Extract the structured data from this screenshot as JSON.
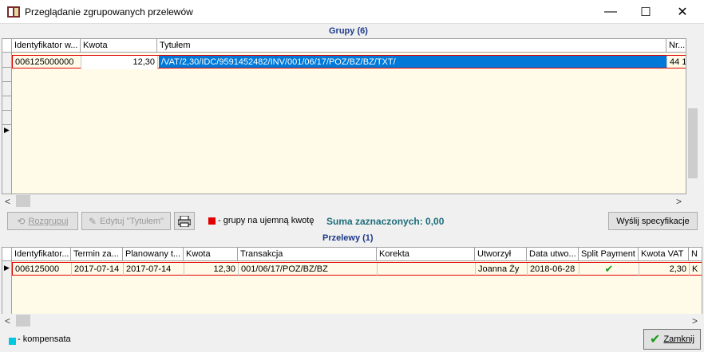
{
  "window": {
    "title": "Przeglądanie zgrupowanych przelewów",
    "min_glyph": "—",
    "max_glyph": "☐",
    "close_glyph": "✕"
  },
  "groups": {
    "title": "Grupy (6)",
    "columns": [
      "Identyfikator w...",
      "Kwota",
      "Tytułem",
      "Nr..."
    ],
    "row": {
      "id": "006125000000",
      "amount": "12,30",
      "title": "/VAT/2,30/IDC/9591452482/INV/001/06/17/POZ/BZ/BZ/TXT/",
      "nr": "44 1"
    }
  },
  "toolbar": {
    "ungroup_label": "Rozgrupuj",
    "edit_title_label": "Edytuj \"Tytułem\"",
    "negative_legend": "- grupy na ujemną kwotę",
    "sum_label": "Suma zaznaczonych: 0,00",
    "send_spec_label": "Wyślij specyfikacje"
  },
  "transfers": {
    "title": "Przelewy (1)",
    "columns": [
      "Identyfikator...",
      "Termin za...",
      "Planowany t...",
      "Kwota",
      "Transakcja",
      "Korekta",
      "Utworzył",
      "Data utwo...",
      "Split Payment",
      "Kwota VAT",
      "N"
    ],
    "row": {
      "id": "006125000",
      "due": "2017-07-14",
      "planned": "2017-07-14",
      "amount": "12,30",
      "transaction": "001/06/17/POZ/BZ/BZ",
      "correction": "",
      "created_by": "Joanna Ży",
      "created_date": "2018-06-28",
      "split_payment_mark": "✔",
      "vat": "2,30",
      "n": "K"
    }
  },
  "footer": {
    "compensation_legend": "- kompensata",
    "close_label": "Zamknij"
  },
  "colors": {
    "selection": "#0078d7",
    "grid_bg": "#fffbe8",
    "negative": "#e00000",
    "compensation": "#00c8e0",
    "sum_text": "#1e6e7a",
    "section_title": "#1e3a8a"
  }
}
